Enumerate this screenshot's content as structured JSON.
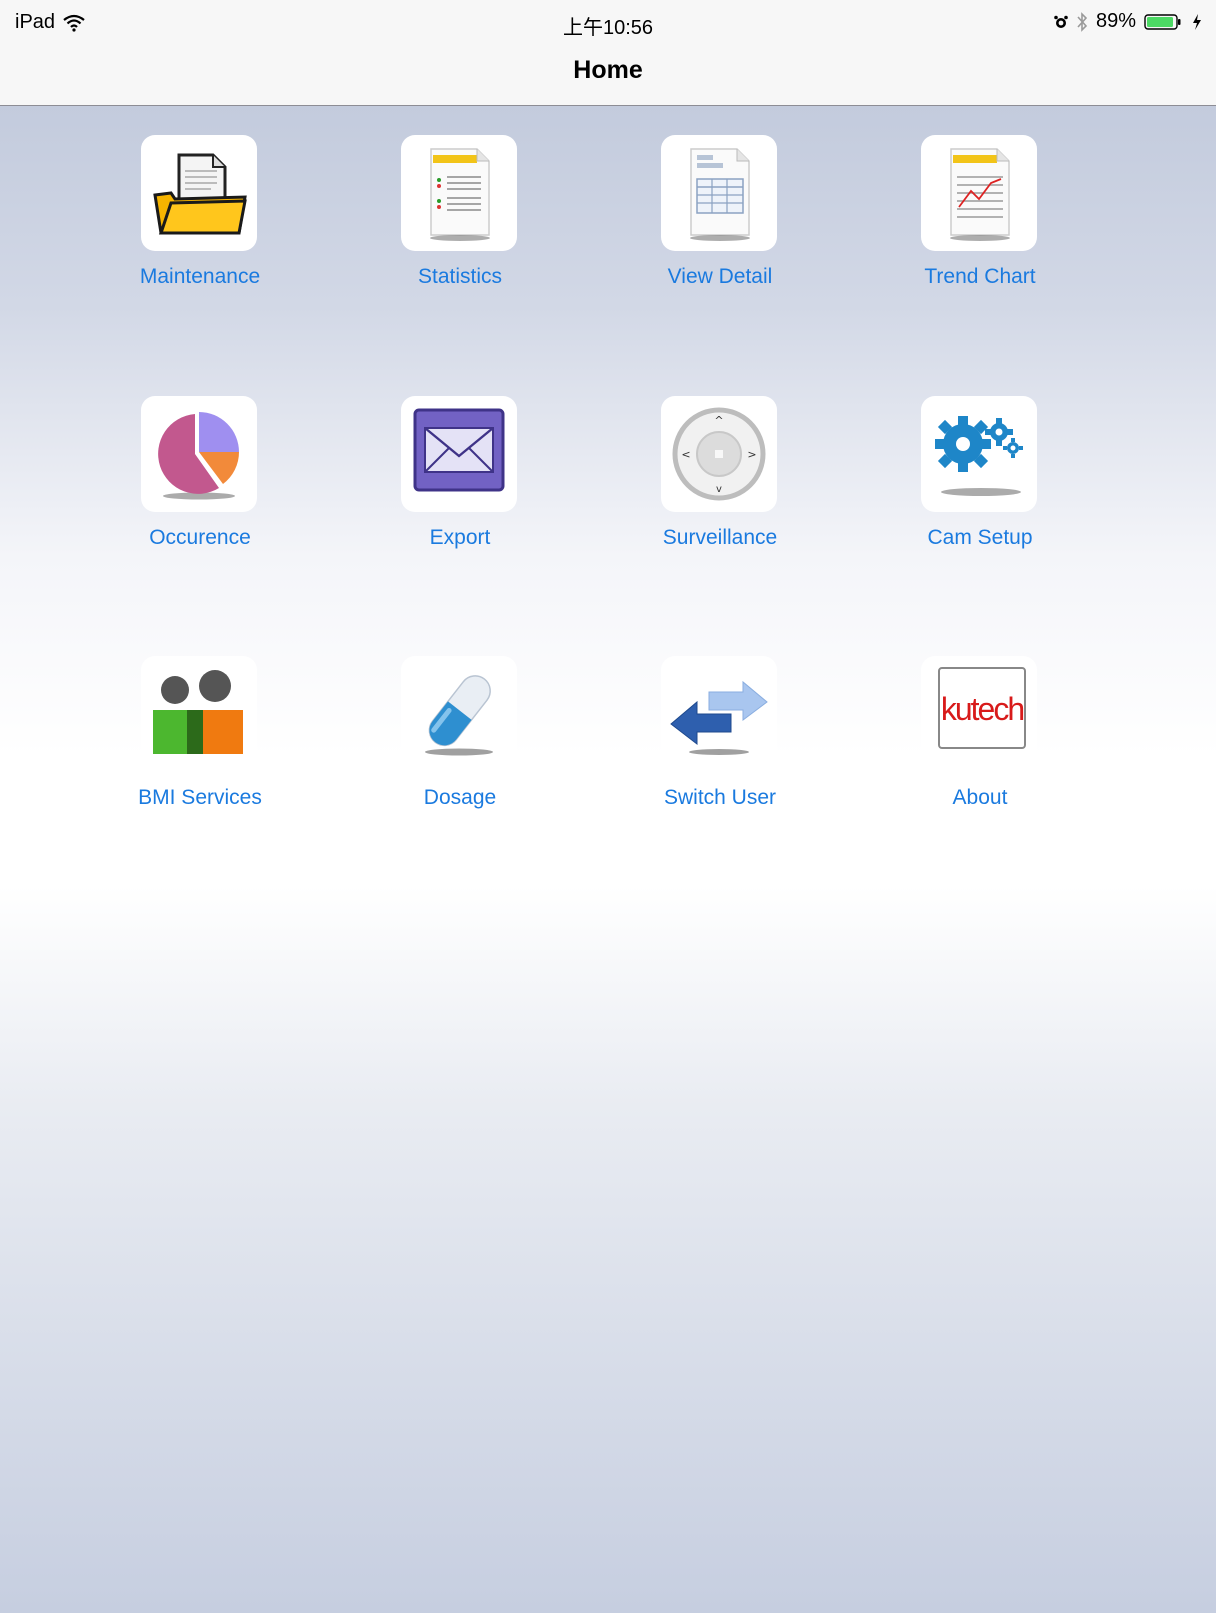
{
  "status_bar": {
    "carrier": "iPad",
    "time": "上午10:56",
    "battery": "89%"
  },
  "nav": {
    "title": "Home"
  },
  "tiles": [
    {
      "label": "Maintenance",
      "icon": "folder-document-icon"
    },
    {
      "label": "Statistics",
      "icon": "statistics-document-icon"
    },
    {
      "label": "View Detail",
      "icon": "table-document-icon"
    },
    {
      "label": "Trend Chart",
      "icon": "trend-chart-document-icon"
    },
    {
      "label": "Occurence",
      "icon": "pie-chart-icon"
    },
    {
      "label": "Export",
      "icon": "envelope-icon"
    },
    {
      "label": "Surveillance",
      "icon": "dpad-controller-icon"
    },
    {
      "label": "Cam Setup",
      "icon": "gears-icon"
    },
    {
      "label": "BMI Services",
      "icon": "people-icon"
    },
    {
      "label": "Dosage",
      "icon": "pill-capsule-icon"
    },
    {
      "label": "Switch User",
      "icon": "swap-arrows-icon"
    },
    {
      "label": "About",
      "icon": "kutech-logo-icon",
      "logo_text": "kutech"
    }
  ],
  "colors": {
    "link_blue": "#1a7adf",
    "bar_bg": "#f7f7f7",
    "bg_top": "#c3cbdd"
  }
}
